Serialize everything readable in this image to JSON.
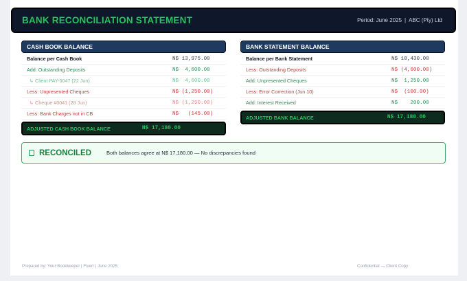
{
  "header": {
    "title": "BANK RECONCILIATION STATEMENT",
    "period": "Period: June 2025",
    "separator": "|",
    "company": "ABC (Pty) Ltd"
  },
  "cash_book": {
    "title": "CASH BOOK BALANCE",
    "rows": [
      {
        "label": "Balance per Cash Book",
        "value": "N$ 13,975.00",
        "style": "bold"
      },
      {
        "label": "Add: Outstanding Deposits",
        "value": "N$  4,600.00",
        "style": "green"
      },
      {
        "label": "↳ Client PAY-0047 (22 Jun)",
        "value": "N$  4,600.00",
        "style": "sub-green"
      },
      {
        "label": "Less: Unpresented Cheques",
        "value": "N$ (1,250.00)",
        "style": "red"
      },
      {
        "label": "↳ Cheque #0041 (28 Jun)",
        "value": "N$ (1,250.00)",
        "style": "sub-red"
      },
      {
        "label": "Less: Bank Charges not in CB",
        "value": "N$   (145.00)",
        "style": "red"
      }
    ],
    "total_label": "ADJUSTED CASH BOOK BALANCE",
    "total_value": "N$ 17,180.00"
  },
  "bank_statement": {
    "title": "BANK STATEMENT BALANCE",
    "rows": [
      {
        "label": "Balance per Bank Statement",
        "value": "N$ 18,430.00",
        "style": "bold"
      },
      {
        "label": "Less: Outstanding Deposits",
        "value": "N$ (4,600.00)",
        "style": "red"
      },
      {
        "label": "Add: Unpresented Cheques",
        "value": "N$  1,250.00",
        "style": "green"
      },
      {
        "label": "Less: Error Correction (Jun 10)",
        "value": "N$  (100.00)",
        "style": "red"
      },
      {
        "label": "Add: Interest Received",
        "value": "N$    200.00",
        "style": "green"
      }
    ],
    "total_label": "ADJUSTED BANK BALANCE",
    "total_value": "N$ 17,180.00"
  },
  "status": {
    "label": "RECONCILED",
    "message": "Both balances agree at  N$ 17,180.00  —  No discrepancies found",
    "color": "#16a34a"
  },
  "footer": {
    "left": "Prepared by: Your Bookkeeper  |  Fiverr  |  June 2025",
    "right": "Confidential — Client Copy"
  }
}
